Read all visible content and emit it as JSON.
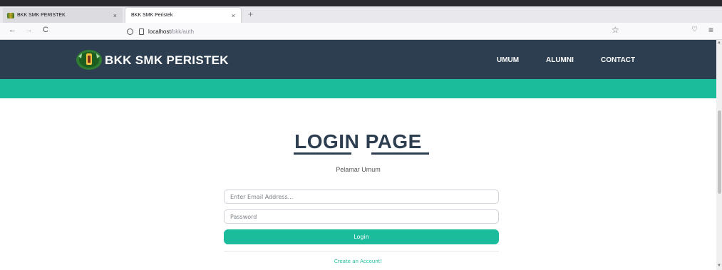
{
  "browser": {
    "tabs": [
      {
        "title": "BKK SMK PERISTEK",
        "close": "×"
      },
      {
        "title": "BKK SMK Peristek",
        "close": "×"
      }
    ],
    "new_tab": "+",
    "back": "←",
    "forward": "→",
    "reload": "C",
    "url_host": "localhost",
    "url_path": "/bkk/auth",
    "star": "☆",
    "pocket": "♡",
    "menu": "≡"
  },
  "navbar": {
    "brand": "BKK SMK PERISTEK",
    "items": [
      "UMUM",
      "ALUMNI",
      "CONTACT"
    ],
    "bg_color": "#2c3e50",
    "accent_color": "#1abc9c"
  },
  "login": {
    "title": "LOGIN PAGE",
    "subtitle": "Pelamar Umum",
    "email_placeholder": "Enter Email Address...",
    "password_placeholder": "Password",
    "button_label": "Login",
    "create_account": "Create an Account!"
  }
}
